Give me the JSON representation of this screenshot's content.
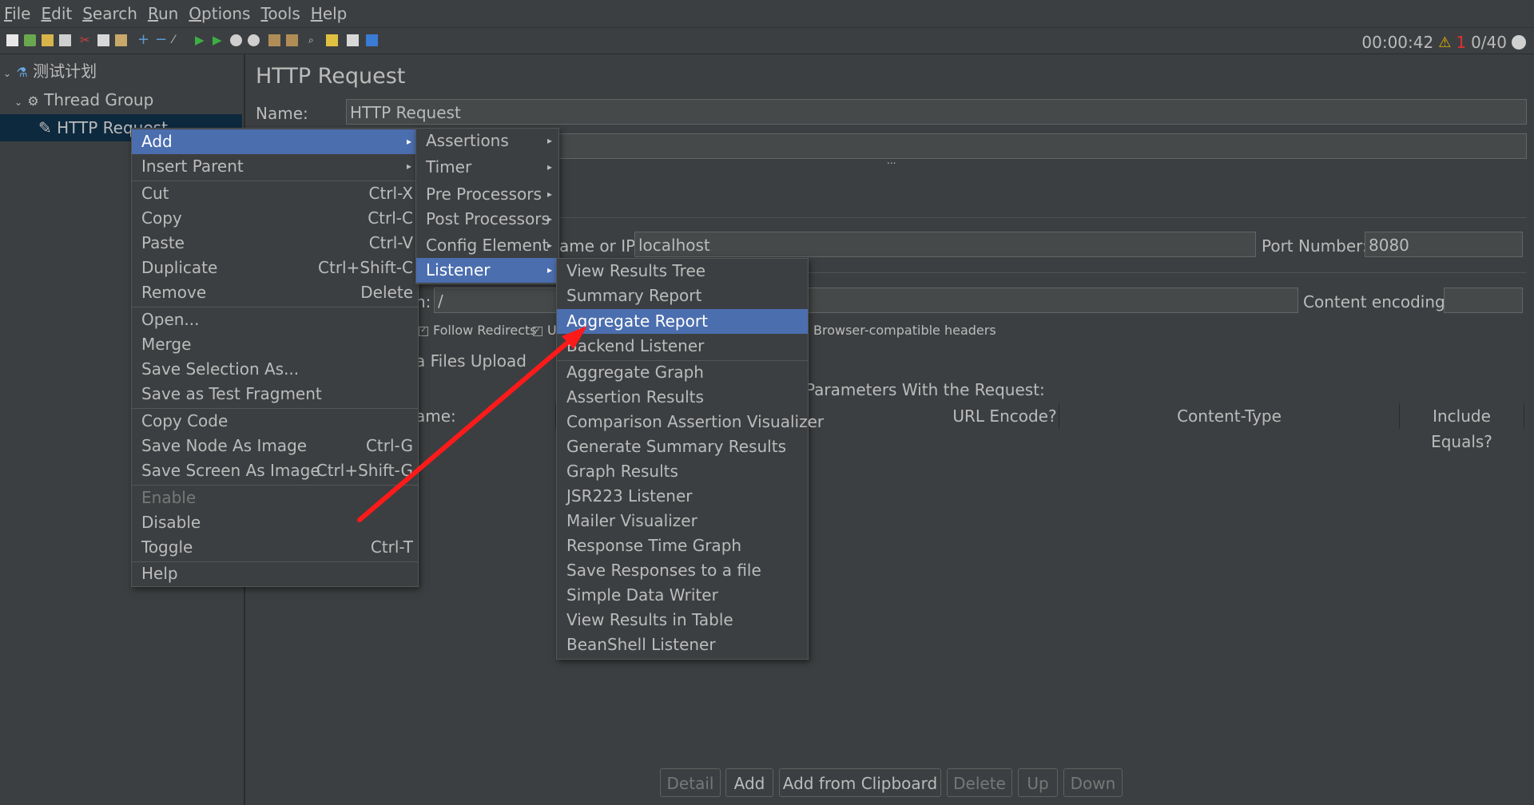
{
  "menubar": [
    "File",
    "Edit",
    "Search",
    "Run",
    "Options",
    "Tools",
    "Help"
  ],
  "status": {
    "timer": "00:00:42",
    "warn_count": "1",
    "threads": "0/40"
  },
  "tree": {
    "root": "测试计划",
    "thread_group": "Thread Group",
    "http_request": "HTTP Request"
  },
  "panel": {
    "title": "HTTP Request",
    "name_label": "Name:",
    "name_value": "HTTP Request",
    "server_label": "ame or IP:",
    "server_value": "localhost",
    "port_label": "Port Number:",
    "port_value": "8080",
    "path_label": "h:",
    "path_value": "/",
    "encoding_label": "Content encoding:",
    "follow_redirects": "Follow Redirects",
    "u_partial": "U",
    "browser_headers": "Browser-compatible headers",
    "files_upload": "a Files Upload",
    "params_label": "Parameters With the Request:",
    "col_name": "ame:",
    "col_urlencode": "URL Encode?",
    "col_content_type": "Content-Type",
    "col_include_equals": "Include Equals?",
    "drag_dots": "..."
  },
  "buttons": {
    "detail": "Detail",
    "add": "Add",
    "add_clipboard": "Add from Clipboard",
    "delete": "Delete",
    "up": "Up",
    "down": "Down"
  },
  "context_menu": {
    "add": "Add",
    "insert_parent": "Insert Parent",
    "cut": "Cut",
    "cut_sc": "Ctrl-X",
    "copy": "Copy",
    "copy_sc": "Ctrl-C",
    "paste": "Paste",
    "paste_sc": "Ctrl-V",
    "duplicate": "Duplicate",
    "duplicate_sc": "Ctrl+Shift-C",
    "remove": "Remove",
    "remove_sc": "Delete",
    "open": "Open...",
    "merge": "Merge",
    "save_selection": "Save Selection As...",
    "save_fragment": "Save as Test Fragment",
    "copy_code": "Copy Code",
    "save_node_image": "Save Node As Image",
    "save_node_image_sc": "Ctrl-G",
    "save_screen_image": "Save Screen As Image",
    "save_screen_image_sc": "Ctrl+Shift-G",
    "enable": "Enable",
    "disable": "Disable",
    "toggle": "Toggle",
    "toggle_sc": "Ctrl-T",
    "help": "Help"
  },
  "add_submenu": [
    "Assertions",
    "Timer",
    "Pre Processors",
    "Post Processors",
    "Config Element",
    "Listener"
  ],
  "listener_submenu": [
    "View Results Tree",
    "Summary Report",
    "Aggregate Report",
    "Backend Listener",
    "Aggregate Graph",
    "Assertion Results",
    "Comparison Assertion Visualizer",
    "Generate Summary Results",
    "Graph Results",
    "JSR223 Listener",
    "Mailer Visualizer",
    "Response Time Graph",
    "Save Responses to a file",
    "Simple Data Writer",
    "View Results in Table",
    "BeanShell Listener"
  ],
  "colors": {
    "highlight": "#4b6eaf",
    "background": "#3c3f41",
    "arrow": "#ff1a1a",
    "warning": "#e8b400"
  }
}
